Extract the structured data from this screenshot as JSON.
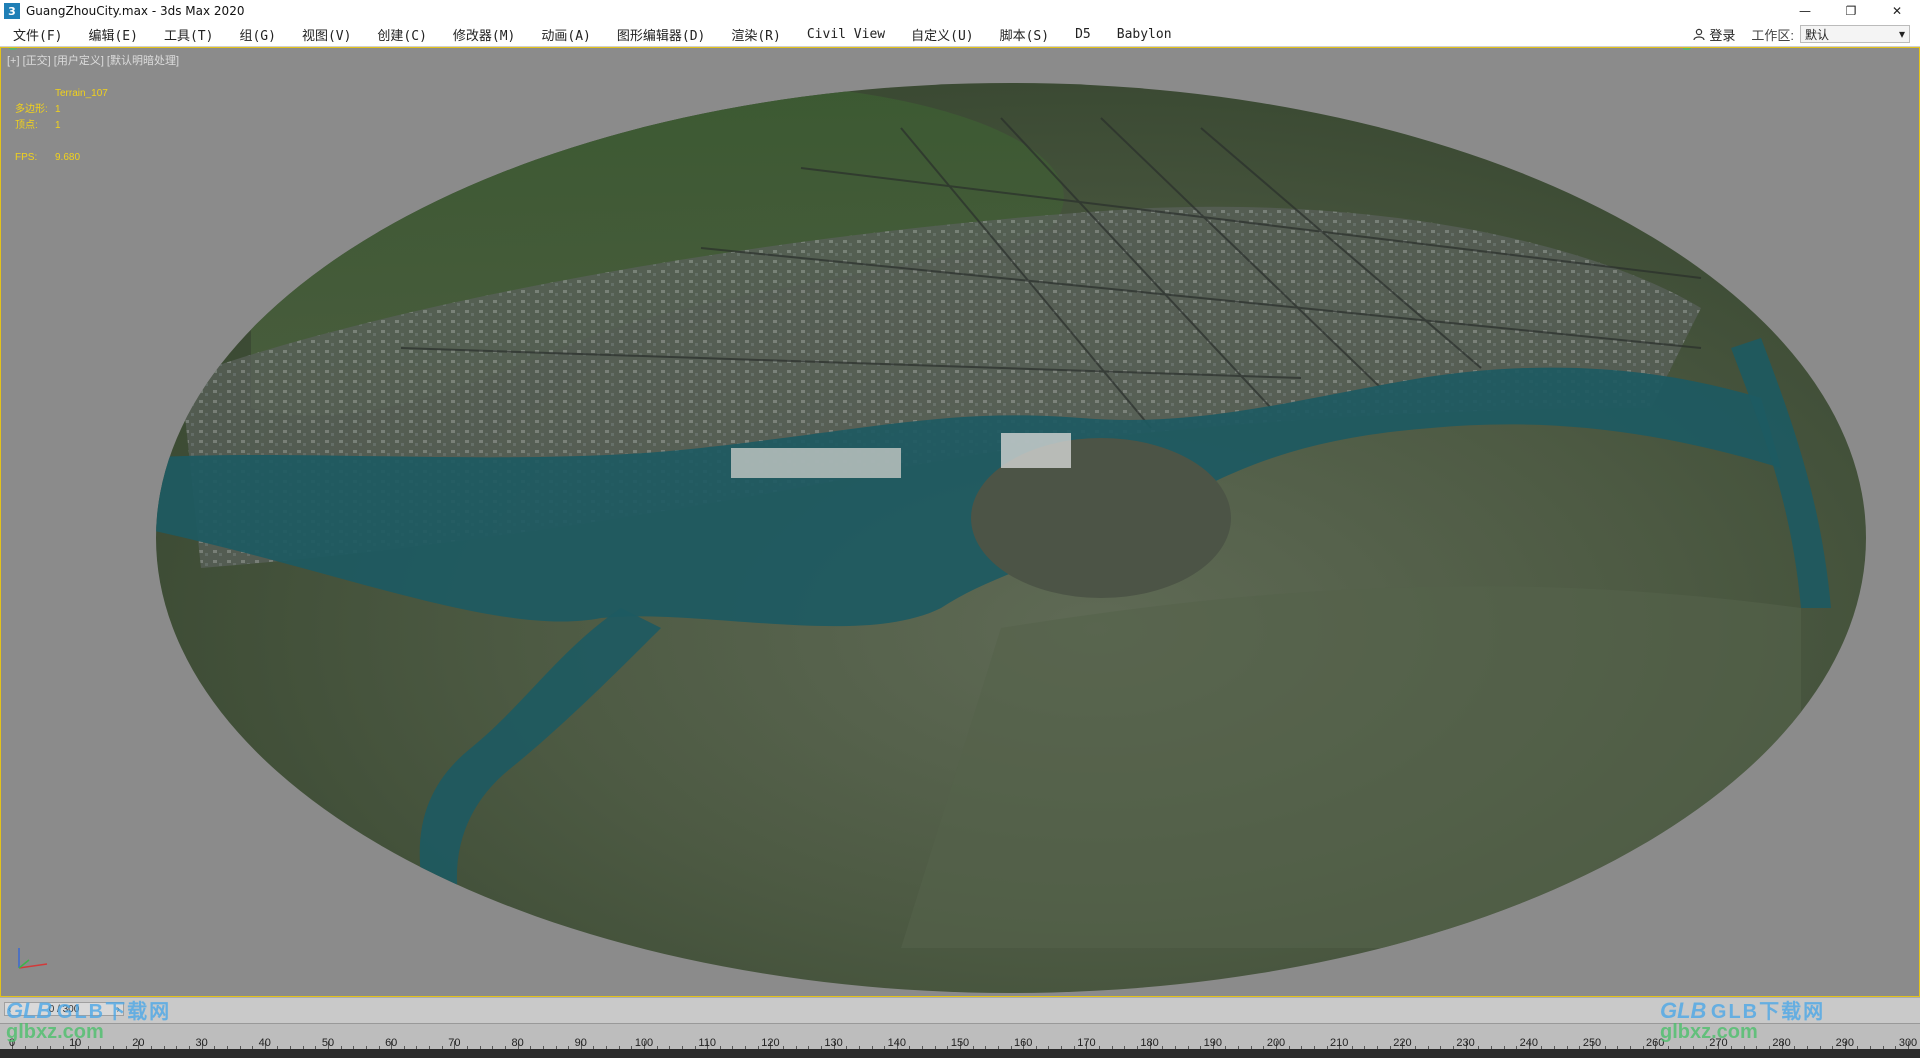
{
  "window": {
    "title": "GuangZhouCity.max - 3ds Max 2020",
    "app_icon": "3",
    "controls": [
      "—",
      "❐",
      "✕"
    ]
  },
  "menu": {
    "items": [
      "文件(F)",
      "编辑(E)",
      "工具(T)",
      "组(G)",
      "视图(V)",
      "创建(C)",
      "修改器(M)",
      "动画(A)",
      "图形编辑器(D)",
      "渲染(R)",
      "Civil View",
      "自定义(U)",
      "脚本(S)",
      "D5",
      "Babylon"
    ],
    "login_label": "登录",
    "workspace_label": "工作区:",
    "workspace_value": "默认"
  },
  "viewport": {
    "label": "[+] [正交] [用户定义] [默认明暗处理]",
    "object_name": "Terrain_107",
    "stats": [
      {
        "key": "多边形:",
        "value": "1"
      },
      {
        "key": "顶点:",
        "value": "1"
      },
      {
        "key": "FPS:",
        "value": "9.680"
      }
    ],
    "accent_color": "#e3c21a"
  },
  "timeline": {
    "current_frame": "0 / 300",
    "ruler_labels": [
      "0",
      "10",
      "20",
      "30",
      "40",
      "50",
      "60",
      "70",
      "80",
      "90",
      "100",
      "110",
      "120",
      "130",
      "140",
      "150",
      "160",
      "170",
      "180",
      "190",
      "200",
      "210",
      "220",
      "230",
      "240",
      "250",
      "260",
      "270",
      "280",
      "290",
      "300"
    ]
  },
  "watermark": {
    "logo": "GLB",
    "cn_text": "GLB下载网",
    "url": "glbxz.com"
  }
}
